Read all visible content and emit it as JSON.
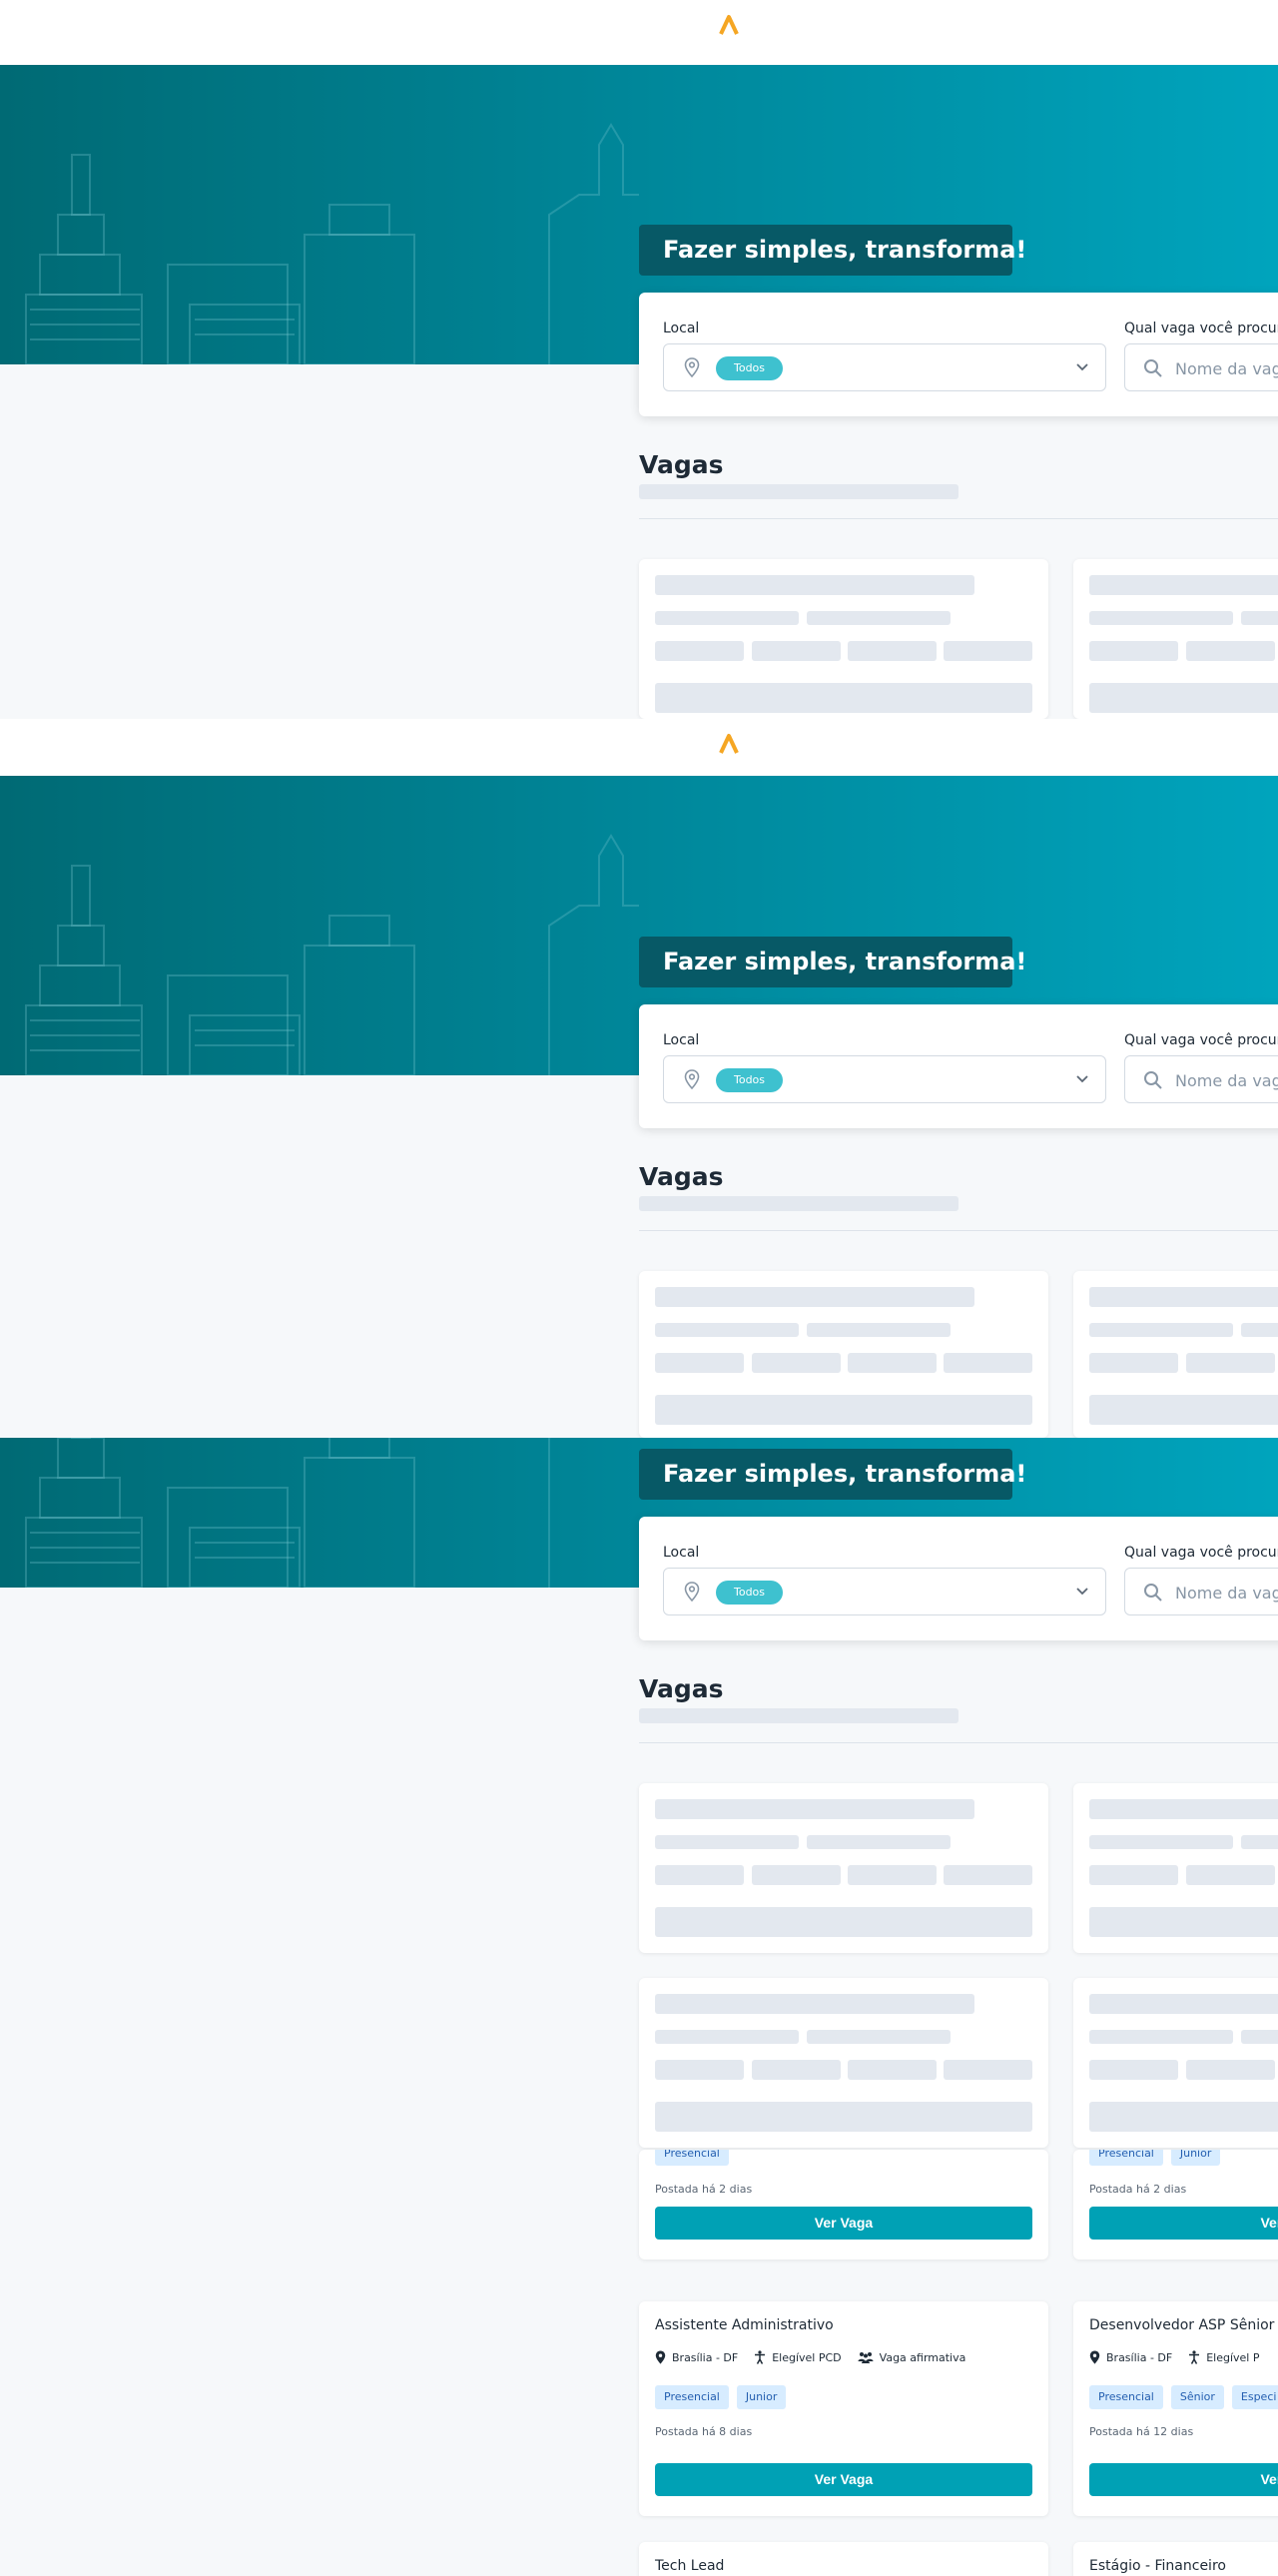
{
  "hero": {
    "tagline": "Fazer simples, transforma!"
  },
  "search": {
    "local_label": "Local",
    "local_value": "Todos",
    "query_label": "Qual vaga você procur",
    "query_placeholder": "Nome da vag"
  },
  "jobs_section": {
    "title": "Vagas"
  },
  "jobs": [
    {
      "title": "",
      "tags": [
        "Presencial"
      ],
      "posted": "Postada há 2 dias",
      "button": "Ver Vaga"
    },
    {
      "title": "",
      "tags": [
        "Presencial",
        "Junior"
      ],
      "posted": "Postada há 2 dias",
      "button": "Ver V"
    },
    {
      "title": "Assistente Administrativo",
      "location": "Brasília - DF",
      "pcd": "Elegível PCD",
      "affirmative": "Vaga afirmativa",
      "tags": [
        "Presencial",
        "Junior"
      ],
      "posted": "Postada há 8 dias",
      "button": "Ver Vaga"
    },
    {
      "title": "Desenvolvedor ASP Sênior",
      "location": "Brasília - DF",
      "pcd": "Elegível P",
      "tags": [
        "Presencial",
        "Sênior",
        "Especi"
      ],
      "posted": "Postada há 12 dias",
      "button": "Ver V"
    },
    {
      "title": "Tech Lead"
    },
    {
      "title": "Estágio - Financeiro"
    }
  ],
  "colors": {
    "brand_teal": "#00a1b5",
    "hero_dark": "#006a74",
    "tagline_bg": "#075966",
    "chip": "#3ec1cf",
    "logo": "#f5a623"
  }
}
